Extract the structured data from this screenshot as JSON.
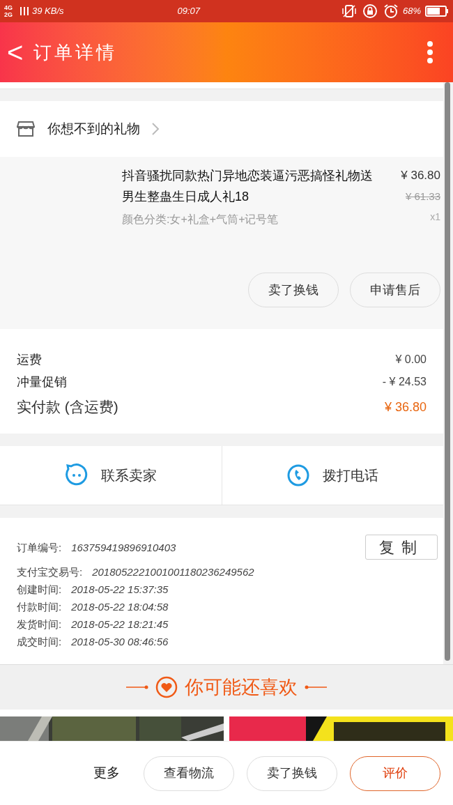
{
  "status_bar": {
    "network": "4G 2G",
    "speed": "39 KB/s",
    "time": "09:07",
    "battery": "68%"
  },
  "header": {
    "back": "<",
    "title": "订单详情"
  },
  "shop": {
    "name": "你想不到的礼物"
  },
  "item": {
    "title": "抖音骚扰同款热门异地恋装逼污恶搞怪礼物送男生整蛊生日成人礼18",
    "price": "¥ 36.80",
    "original_price": "¥ 61.33",
    "sku": "颜色分类:女+礼盒+气筒+记号笔",
    "quantity": "x1",
    "actions": [
      "卖了换钱",
      "申请售后"
    ]
  },
  "costs": [
    {
      "label": "运费",
      "value": "¥ 0.00",
      "kind": "normal"
    },
    {
      "label": "冲量促销",
      "value": "- ¥ 24.53",
      "kind": "normal"
    },
    {
      "label": "实付款 (含运费)",
      "value": "¥ 36.80",
      "kind": "total"
    }
  ],
  "contact": [
    {
      "label": "联系卖家",
      "kind": "chat"
    },
    {
      "label": "拨打电话",
      "kind": "phone"
    }
  ],
  "order_info": {
    "copy_button": "复制",
    "rows": [
      {
        "label": "订单编号:",
        "value": "163759419896910403"
      },
      {
        "label": "支付宝交易号:",
        "value": "2018052221001001180236249562"
      },
      {
        "label": "创建时间:",
        "value": "2018-05-22 15:37:35"
      },
      {
        "label": "付款时间:",
        "value": "2018-05-22 18:04:58"
      },
      {
        "label": "发货时间:",
        "value": "2018-05-22 18:21:45"
      },
      {
        "label": "成交时间:",
        "value": "2018-05-30 08:46:56"
      }
    ]
  },
  "recommend": {
    "title": "你可能还喜欢"
  },
  "bottom_bar": {
    "more": "更多",
    "buttons": [
      {
        "label": "查看物流",
        "primary": false
      },
      {
        "label": "卖了换钱",
        "primary": false
      },
      {
        "label": "评价",
        "primary": true
      }
    ]
  }
}
